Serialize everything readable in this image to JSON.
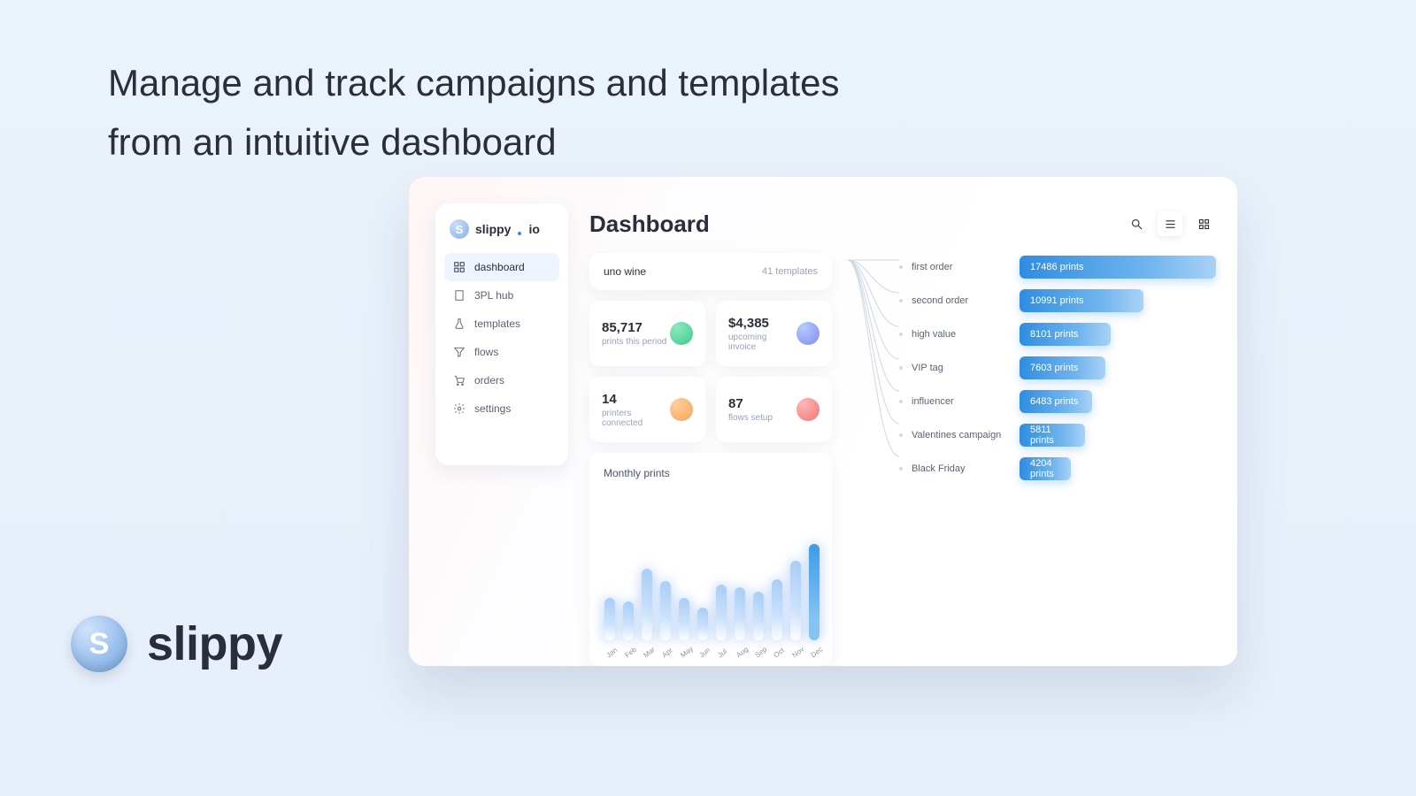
{
  "headline_line1": "Manage and track campaigns and templates",
  "headline_line2": "from an intuitive dashboard",
  "footer_brand": "slippy",
  "brand": {
    "name_a": "slippy",
    "name_b": "io"
  },
  "sidebar": {
    "items": [
      {
        "label": "dashboard",
        "icon": "dashboard-icon",
        "active": true
      },
      {
        "label": "3PL hub",
        "icon": "building-icon",
        "active": false
      },
      {
        "label": "templates",
        "icon": "flask-icon",
        "active": false
      },
      {
        "label": "flows",
        "icon": "funnel-icon",
        "active": false
      },
      {
        "label": "orders",
        "icon": "cart-icon",
        "active": false
      },
      {
        "label": "settings",
        "icon": "gear-icon",
        "active": false
      }
    ]
  },
  "page_title": "Dashboard",
  "project_header": {
    "name": "uno wine",
    "subtitle": "41 templates"
  },
  "stats": [
    {
      "value": "85,717",
      "label": "prints this period",
      "color": "sg"
    },
    {
      "value": "$4,385",
      "label": "upcoming invoice",
      "color": "sb"
    },
    {
      "value": "14",
      "label": "printers connected",
      "color": "so"
    },
    {
      "value": "87",
      "label": "flows setup",
      "color": "sr"
    }
  ],
  "chart_title": "Monthly prints",
  "chart_data": {
    "type": "bar",
    "title": "Monthly prints",
    "xlabel": "",
    "ylabel": "",
    "ylim": [
      0,
      100
    ],
    "categories": [
      "Jan",
      "Feb",
      "Mar",
      "Apr",
      "May",
      "Jun",
      "Jul",
      "Aug",
      "Sep",
      "Oct",
      "Nov",
      "Dec"
    ],
    "values": [
      42,
      38,
      70,
      58,
      42,
      32,
      55,
      52,
      48,
      60,
      78,
      95
    ]
  },
  "templates": [
    {
      "name": "first order",
      "prints": 17486,
      "label": "17486 prints"
    },
    {
      "name": "second order",
      "prints": 10991,
      "label": "10991 prints"
    },
    {
      "name": "high value",
      "prints": 8101,
      "label": "8101 prints"
    },
    {
      "name": "VIP tag",
      "prints": 7603,
      "label": "7603 prints"
    },
    {
      "name": "influencer",
      "prints": 6483,
      "label": "6483 prints"
    },
    {
      "name": "Valentines campaign",
      "prints": 5811,
      "label": "5811 prints"
    },
    {
      "name": "Black Friday",
      "prints": 4204,
      "label": "4204 prints"
    }
  ],
  "template_bar_max": 17486
}
